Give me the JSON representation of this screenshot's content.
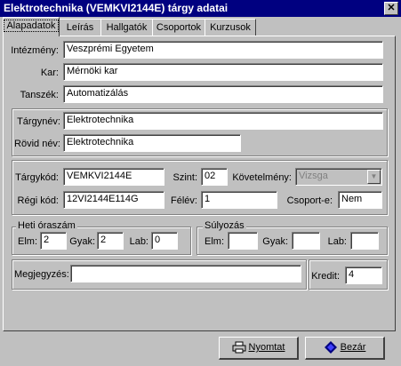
{
  "window": {
    "title": "Elektrotechnika (VEMKVI2144E) tárgy adatai"
  },
  "tabs": [
    "Alapadatok",
    "Leírás",
    "Hallgatók",
    "Csoportok",
    "Kurzusok"
  ],
  "org": {
    "intezmeny_label": "Intézmény:",
    "intezmeny_value": "Veszprémi Egyetem",
    "kar_label": "Kar:",
    "kar_value": "Mérnöki kar",
    "tanszek_label": "Tanszék:",
    "tanszek_value": "Automatizálás"
  },
  "subject": {
    "targynev_label": "Tárgynév:",
    "targynev_value": "Elektrotechnika",
    "rovidnev_label": "Rövid név:",
    "rovidnev_value": "Elektrotechnika"
  },
  "codes": {
    "targykod_label": "Tárgykód:",
    "targykod_value": "VEMKVI2144E",
    "szint_label": "Szint:",
    "szint_value": "02",
    "kovetelmeny_label": "Követelmény:",
    "kovetelmeny_value": "Vizsga",
    "regikod_label": "Régi kód:",
    "regikod_value": "12VI2144E114G",
    "felev_label": "Félév:",
    "felev_value": "1",
    "csoport_label": "Csoport-e:",
    "csoport_value": "Nem"
  },
  "hours": {
    "legend": "Heti óraszám",
    "elm_label": "Elm:",
    "elm_value": "2",
    "gyak_label": "Gyak:",
    "gyak_value": "2",
    "lab_label": "Lab:",
    "lab_value": "0"
  },
  "weights": {
    "legend": "Súlyozás",
    "elm_label": "Elm:",
    "elm_value": "",
    "gyak_label": "Gyak:",
    "gyak_value": "",
    "lab_label": "Lab:",
    "lab_value": ""
  },
  "misc": {
    "megjegyzes_label": "Megjegyzés:",
    "megjegyzes_value": "",
    "kredit_label": "Kredit:",
    "kredit_value": "4"
  },
  "buttons": {
    "print": "Nyomtat",
    "close": "Bezár"
  },
  "icons": {
    "print": "printer-icon",
    "close": "diamond-close-icon"
  }
}
